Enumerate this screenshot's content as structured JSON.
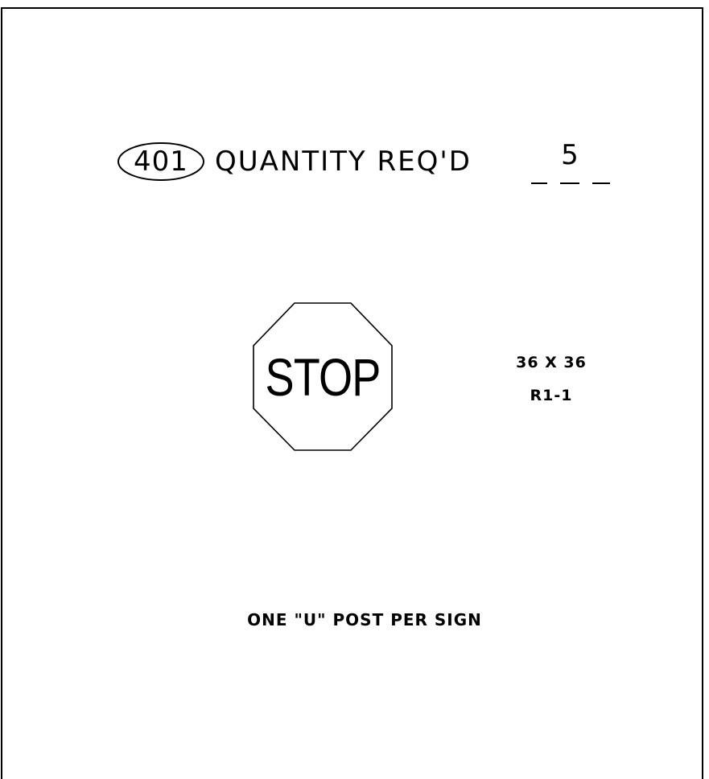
{
  "item": {
    "number": "401",
    "quantity_label": "QUANTITY REQ'D",
    "quantity_value": "5"
  },
  "sign": {
    "legend": "STOP",
    "size": "36 X 36",
    "code": "R1-1",
    "shape_icon": "octagon-stop-sign-icon"
  },
  "note": "ONE \"U\" POST PER SIGN"
}
